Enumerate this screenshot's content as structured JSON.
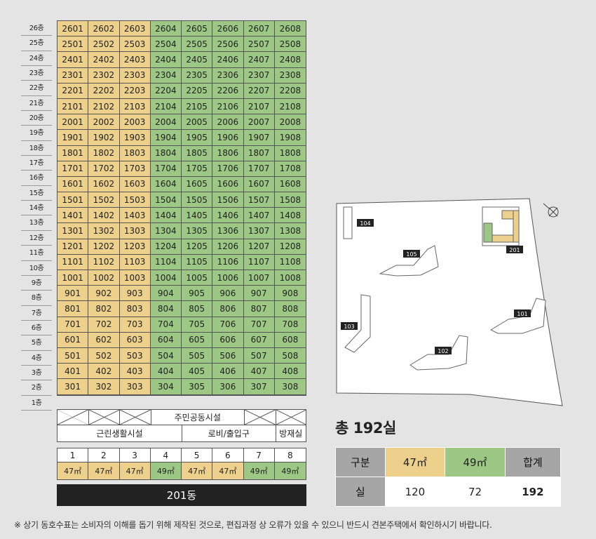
{
  "floors": [
    "26층",
    "25층",
    "24층",
    "23층",
    "22층",
    "21층",
    "20층",
    "19층",
    "18층",
    "17층",
    "16층",
    "15층",
    "14층",
    "13층",
    "12층",
    "11층",
    "10층",
    "9층",
    "8층",
    "7층",
    "6층",
    "5층",
    "4층",
    "3층",
    "2층",
    "1층"
  ],
  "units": [
    [
      "2601",
      "2602",
      "2603",
      "2604",
      "2605",
      "2606",
      "2607",
      "2608"
    ],
    [
      "2501",
      "2502",
      "2503",
      "2504",
      "2505",
      "2506",
      "2507",
      "2508"
    ],
    [
      "2401",
      "2402",
      "2403",
      "2404",
      "2405",
      "2406",
      "2407",
      "2408"
    ],
    [
      "2301",
      "2302",
      "2303",
      "2304",
      "2305",
      "2306",
      "2307",
      "2308"
    ],
    [
      "2201",
      "2202",
      "2203",
      "2204",
      "2205",
      "2206",
      "2207",
      "2208"
    ],
    [
      "2101",
      "2102",
      "2103",
      "2104",
      "2105",
      "2106",
      "2107",
      "2108"
    ],
    [
      "2001",
      "2002",
      "2003",
      "2004",
      "2005",
      "2006",
      "2007",
      "2008"
    ],
    [
      "1901",
      "1902",
      "1903",
      "1904",
      "1905",
      "1906",
      "1907",
      "1908"
    ],
    [
      "1801",
      "1802",
      "1803",
      "1804",
      "1805",
      "1806",
      "1807",
      "1808"
    ],
    [
      "1701",
      "1702",
      "1703",
      "1704",
      "1705",
      "1706",
      "1707",
      "1708"
    ],
    [
      "1601",
      "1602",
      "1603",
      "1604",
      "1605",
      "1606",
      "1607",
      "1608"
    ],
    [
      "1501",
      "1502",
      "1503",
      "1504",
      "1505",
      "1506",
      "1507",
      "1508"
    ],
    [
      "1401",
      "1402",
      "1403",
      "1404",
      "1405",
      "1406",
      "1407",
      "1408"
    ],
    [
      "1301",
      "1302",
      "1303",
      "1304",
      "1305",
      "1306",
      "1307",
      "1308"
    ],
    [
      "1201",
      "1202",
      "1203",
      "1204",
      "1205",
      "1206",
      "1207",
      "1208"
    ],
    [
      "1101",
      "1102",
      "1103",
      "1104",
      "1105",
      "1106",
      "1107",
      "1108"
    ],
    [
      "1001",
      "1002",
      "1003",
      "1004",
      "1005",
      "1006",
      "1007",
      "1008"
    ],
    [
      "901",
      "902",
      "903",
      "904",
      "905",
      "906",
      "907",
      "908"
    ],
    [
      "801",
      "802",
      "803",
      "804",
      "805",
      "806",
      "807",
      "808"
    ],
    [
      "701",
      "702",
      "703",
      "704",
      "705",
      "706",
      "707",
      "708"
    ],
    [
      "601",
      "602",
      "603",
      "604",
      "605",
      "606",
      "607",
      "608"
    ],
    [
      "501",
      "502",
      "503",
      "504",
      "505",
      "506",
      "507",
      "508"
    ],
    [
      "401",
      "402",
      "403",
      "404",
      "405",
      "406",
      "407",
      "408"
    ],
    [
      "301",
      "302",
      "303",
      "304",
      "305",
      "306",
      "307",
      "308"
    ]
  ],
  "line_types": [
    "y",
    "y",
    "y",
    "g",
    "g",
    "g",
    "g",
    "g"
  ],
  "facilities": {
    "community": "주민공동시설",
    "neighborhood": "근린생활시설",
    "lobby": "로비/출입구",
    "disaster_room": "방재실"
  },
  "lines": [
    {
      "no": "1",
      "size": "47㎡",
      "type": "y"
    },
    {
      "no": "2",
      "size": "47㎡",
      "type": "y"
    },
    {
      "no": "3",
      "size": "47㎡",
      "type": "y"
    },
    {
      "no": "4",
      "size": "49㎡",
      "type": "g"
    },
    {
      "no": "5",
      "size": "47㎡",
      "type": "y"
    },
    {
      "no": "6",
      "size": "47㎡",
      "type": "y"
    },
    {
      "no": "7",
      "size": "49㎡",
      "type": "g"
    },
    {
      "no": "8",
      "size": "49㎡",
      "type": "g"
    }
  ],
  "building_name": "201동",
  "site_labels": {
    "b104": "104",
    "b105": "105",
    "b103": "103",
    "b102": "102",
    "b101": "101",
    "b201": "201"
  },
  "total": "총 192실",
  "summary": {
    "h_type": "구분",
    "h_47": "47㎡",
    "h_49": "49㎡",
    "h_sum": "합계",
    "r_label": "실",
    "v_47": "120",
    "v_49": "72",
    "v_sum": "192"
  },
  "note": "※ 상기 동호수표는 소비자의 이해를 돕기 위해 제작된 것으로, 편집과정 상 오류가 있을 수 있으니 반드시 견본주택에서 확인하시기 바랍니다.",
  "colors": {
    "type_47": "#ecd08c",
    "type_49": "#9cc784",
    "building_bar": "#222222",
    "header_gray": "#a6a6a6"
  }
}
